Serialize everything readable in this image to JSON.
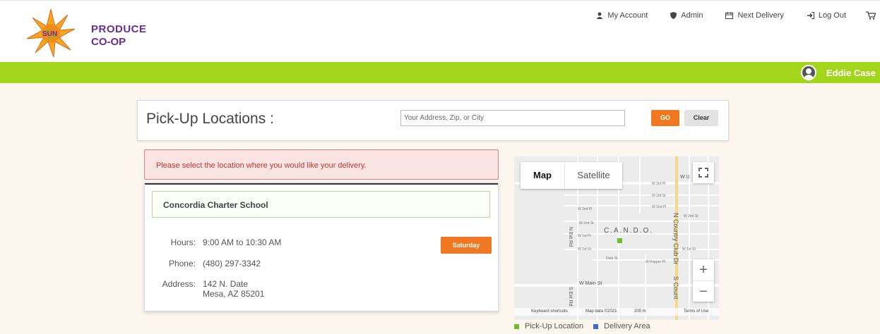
{
  "logo": {
    "sun": "SUN",
    "word1": "PRODUCE",
    "word2": "CO-OP"
  },
  "topnav": {
    "my_account": "My Account",
    "admin": "Admin",
    "next_delivery": "Next Delivery",
    "log_out": "Log Out"
  },
  "user": {
    "name": "Eddie Case"
  },
  "pickup": {
    "title": "Pick-Up Locations :",
    "search_placeholder": "Your Address, Zip, or City",
    "go_label": "GO",
    "clear_label": "Clear"
  },
  "alert": "Please select the location where you would like your delivery.",
  "location": {
    "name": "Concordia Charter School",
    "hours_label": "Hours:",
    "hours": "9:00 AM to 10:30 AM",
    "phone_label": "Phone:",
    "phone": "(480) 297-3342",
    "address_label": "Address:",
    "address_line1": "142 N. Date",
    "address_line2": "Mesa, AZ 85201",
    "day_button": "Saturday"
  },
  "map": {
    "tab_map": "Map",
    "tab_satellite": "Satellite",
    "place": "C.A.N.D.O.",
    "keyboard": "Keyboard shortcuts",
    "map_data": "Map data ©2021",
    "scale": "200 m",
    "terms": "Terms of Use",
    "streets": {
      "w3rd": "W 3rd Pl",
      "w3rdst": "W 3rd St",
      "w2ndpl": "W 2nd Pl",
      "w2ndst": "W 2nd St",
      "w1stpl": "W 1st Pl",
      "w1stst": "W 1st St",
      "date": "Date St",
      "pepper": "W Pepper Pl",
      "main": "W Main St",
      "ncountry": "N Country Club Dr",
      "scountry": "S Count",
      "next": "N Ext Rd",
      "sext": "S Ext Rd",
      "wu": "W U"
    },
    "zoom_in": "+",
    "zoom_out": "−"
  },
  "legend": {
    "pickup": "Pick-Up Location",
    "delivery": "Delivery Area",
    "pickup_color": "#6fbf2b",
    "delivery_color": "#3a6fc4"
  },
  "colors": {
    "accent_green": "#a3d51b",
    "accent_orange": "#f07820",
    "brand_purple": "#6b2d91"
  }
}
